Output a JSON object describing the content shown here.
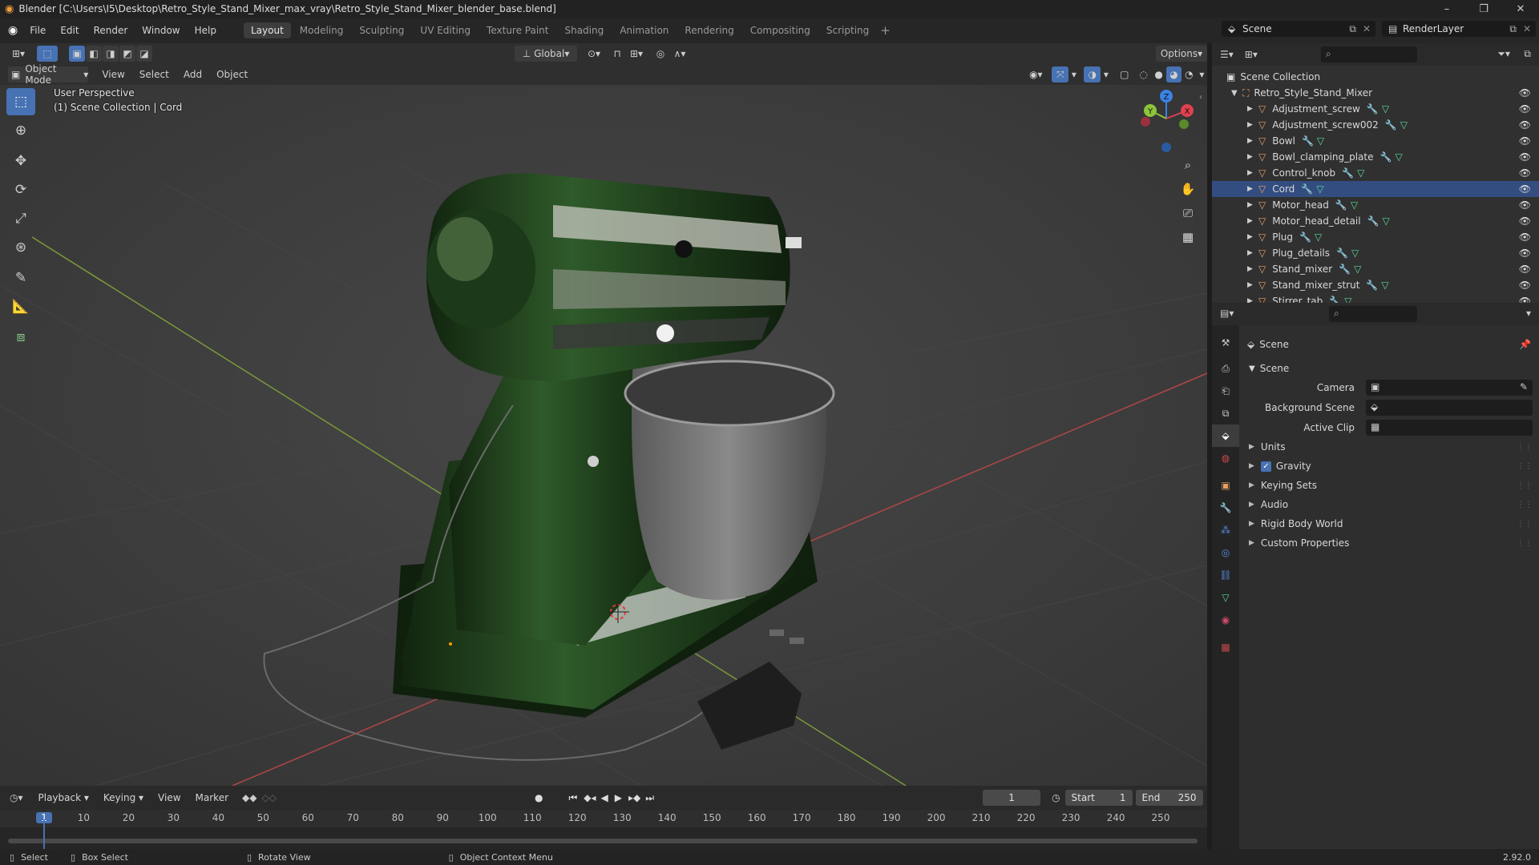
{
  "window": {
    "title": "Blender [C:\\Users\\I5\\Desktop\\Retro_Style_Stand_Mixer_max_vray\\Retro_Style_Stand_Mixer_blender_base.blend]",
    "min": "–",
    "max": "❐",
    "close": "✕"
  },
  "menu": [
    "File",
    "Edit",
    "Render",
    "Window",
    "Help"
  ],
  "workspaces": [
    {
      "label": "Layout",
      "active": true
    },
    {
      "label": "Modeling"
    },
    {
      "label": "Sculpting"
    },
    {
      "label": "UV Editing"
    },
    {
      "label": "Texture Paint"
    },
    {
      "label": "Shading"
    },
    {
      "label": "Animation"
    },
    {
      "label": "Rendering"
    },
    {
      "label": "Compositing"
    },
    {
      "label": "Scripting"
    }
  ],
  "scene_name": "Scene",
  "view_layer": "RenderLayer",
  "viewport_header": {
    "transform_orientation": "Global",
    "options": "Options",
    "mode": "Object Mode",
    "menus": [
      "View",
      "Select",
      "Add",
      "Object"
    ]
  },
  "viewport": {
    "perspective_label": "User Perspective",
    "collection_label": "(1) Scene Collection | Cord"
  },
  "gizmo": {
    "x": "X",
    "y": "Y",
    "z": "Z"
  },
  "outliner": {
    "root": "Scene Collection",
    "collection": "Retro_Style_Stand_Mixer",
    "objects": [
      "Adjustment_screw",
      "Adjustment_screw002",
      "Bowl",
      "Bowl_clamping_plate",
      "Control_knob",
      "Cord",
      "Motor_head",
      "Motor_head_detail",
      "Plug",
      "Plug_details",
      "Stand_mixer",
      "Stand_mixer_strut",
      "Stirrer_tab"
    ],
    "selected": "Cord"
  },
  "properties": {
    "context": "Scene",
    "panel": "Scene",
    "fields": [
      {
        "label": "Camera"
      },
      {
        "label": "Background Scene"
      },
      {
        "label": "Active Clip"
      }
    ],
    "sections": [
      {
        "label": "Units"
      },
      {
        "label": "Gravity",
        "checkbox": true
      },
      {
        "label": "Keying Sets"
      },
      {
        "label": "Audio"
      },
      {
        "label": "Rigid Body World"
      },
      {
        "label": "Custom Properties"
      }
    ]
  },
  "timeline": {
    "menus": [
      "Playback",
      "Keying",
      "View",
      "Marker"
    ],
    "current_frame": "1",
    "start_label": "Start",
    "start": "1",
    "end_label": "End",
    "end": "250",
    "ticks": [
      "1",
      "10",
      "20",
      "30",
      "40",
      "50",
      "60",
      "70",
      "80",
      "90",
      "100",
      "110",
      "120",
      "130",
      "140",
      "150",
      "160",
      "170",
      "180",
      "190",
      "200",
      "210",
      "220",
      "230",
      "240",
      "250"
    ]
  },
  "statusbar": {
    "items": [
      "Select",
      "Box Select",
      "Rotate View",
      "Object Context Menu"
    ],
    "version": "2.92.0"
  },
  "colors": {
    "accent": "#4772b3",
    "selected_row": "#334d80",
    "mixer_green": "#1f3a1c",
    "x_axis": "#e04050",
    "y_axis": "#8cc43a",
    "z_axis": "#3b82e6",
    "mesh_icon": "#e8a060",
    "data_icon": "#59d99b"
  }
}
